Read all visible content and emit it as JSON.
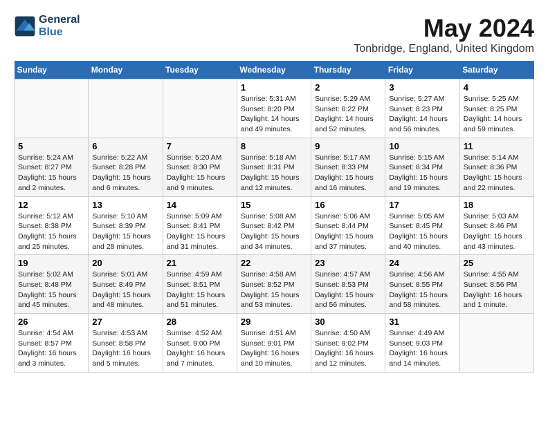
{
  "header": {
    "logo_line1": "General",
    "logo_line2": "Blue",
    "title": "May 2024",
    "subtitle": "Tonbridge, England, United Kingdom"
  },
  "calendar": {
    "days_of_week": [
      "Sunday",
      "Monday",
      "Tuesday",
      "Wednesday",
      "Thursday",
      "Friday",
      "Saturday"
    ],
    "weeks": [
      [
        {
          "num": "",
          "info": ""
        },
        {
          "num": "",
          "info": ""
        },
        {
          "num": "",
          "info": ""
        },
        {
          "num": "1",
          "info": "Sunrise: 5:31 AM\nSunset: 8:20 PM\nDaylight: 14 hours\nand 49 minutes."
        },
        {
          "num": "2",
          "info": "Sunrise: 5:29 AM\nSunset: 8:22 PM\nDaylight: 14 hours\nand 52 minutes."
        },
        {
          "num": "3",
          "info": "Sunrise: 5:27 AM\nSunset: 8:23 PM\nDaylight: 14 hours\nand 56 minutes."
        },
        {
          "num": "4",
          "info": "Sunrise: 5:25 AM\nSunset: 8:25 PM\nDaylight: 14 hours\nand 59 minutes."
        }
      ],
      [
        {
          "num": "5",
          "info": "Sunrise: 5:24 AM\nSunset: 8:27 PM\nDaylight: 15 hours\nand 2 minutes."
        },
        {
          "num": "6",
          "info": "Sunrise: 5:22 AM\nSunset: 8:28 PM\nDaylight: 15 hours\nand 6 minutes."
        },
        {
          "num": "7",
          "info": "Sunrise: 5:20 AM\nSunset: 8:30 PM\nDaylight: 15 hours\nand 9 minutes."
        },
        {
          "num": "8",
          "info": "Sunrise: 5:18 AM\nSunset: 8:31 PM\nDaylight: 15 hours\nand 12 minutes."
        },
        {
          "num": "9",
          "info": "Sunrise: 5:17 AM\nSunset: 8:33 PM\nDaylight: 15 hours\nand 16 minutes."
        },
        {
          "num": "10",
          "info": "Sunrise: 5:15 AM\nSunset: 8:34 PM\nDaylight: 15 hours\nand 19 minutes."
        },
        {
          "num": "11",
          "info": "Sunrise: 5:14 AM\nSunset: 8:36 PM\nDaylight: 15 hours\nand 22 minutes."
        }
      ],
      [
        {
          "num": "12",
          "info": "Sunrise: 5:12 AM\nSunset: 8:38 PM\nDaylight: 15 hours\nand 25 minutes."
        },
        {
          "num": "13",
          "info": "Sunrise: 5:10 AM\nSunset: 8:39 PM\nDaylight: 15 hours\nand 28 minutes."
        },
        {
          "num": "14",
          "info": "Sunrise: 5:09 AM\nSunset: 8:41 PM\nDaylight: 15 hours\nand 31 minutes."
        },
        {
          "num": "15",
          "info": "Sunrise: 5:08 AM\nSunset: 8:42 PM\nDaylight: 15 hours\nand 34 minutes."
        },
        {
          "num": "16",
          "info": "Sunrise: 5:06 AM\nSunset: 8:44 PM\nDaylight: 15 hours\nand 37 minutes."
        },
        {
          "num": "17",
          "info": "Sunrise: 5:05 AM\nSunset: 8:45 PM\nDaylight: 15 hours\nand 40 minutes."
        },
        {
          "num": "18",
          "info": "Sunrise: 5:03 AM\nSunset: 8:46 PM\nDaylight: 15 hours\nand 43 minutes."
        }
      ],
      [
        {
          "num": "19",
          "info": "Sunrise: 5:02 AM\nSunset: 8:48 PM\nDaylight: 15 hours\nand 45 minutes."
        },
        {
          "num": "20",
          "info": "Sunrise: 5:01 AM\nSunset: 8:49 PM\nDaylight: 15 hours\nand 48 minutes."
        },
        {
          "num": "21",
          "info": "Sunrise: 4:59 AM\nSunset: 8:51 PM\nDaylight: 15 hours\nand 51 minutes."
        },
        {
          "num": "22",
          "info": "Sunrise: 4:58 AM\nSunset: 8:52 PM\nDaylight: 15 hours\nand 53 minutes."
        },
        {
          "num": "23",
          "info": "Sunrise: 4:57 AM\nSunset: 8:53 PM\nDaylight: 15 hours\nand 56 minutes."
        },
        {
          "num": "24",
          "info": "Sunrise: 4:56 AM\nSunset: 8:55 PM\nDaylight: 15 hours\nand 58 minutes."
        },
        {
          "num": "25",
          "info": "Sunrise: 4:55 AM\nSunset: 8:56 PM\nDaylight: 16 hours\nand 1 minute."
        }
      ],
      [
        {
          "num": "26",
          "info": "Sunrise: 4:54 AM\nSunset: 8:57 PM\nDaylight: 16 hours\nand 3 minutes."
        },
        {
          "num": "27",
          "info": "Sunrise: 4:53 AM\nSunset: 8:58 PM\nDaylight: 16 hours\nand 5 minutes."
        },
        {
          "num": "28",
          "info": "Sunrise: 4:52 AM\nSunset: 9:00 PM\nDaylight: 16 hours\nand 7 minutes."
        },
        {
          "num": "29",
          "info": "Sunrise: 4:51 AM\nSunset: 9:01 PM\nDaylight: 16 hours\nand 10 minutes."
        },
        {
          "num": "30",
          "info": "Sunrise: 4:50 AM\nSunset: 9:02 PM\nDaylight: 16 hours\nand 12 minutes."
        },
        {
          "num": "31",
          "info": "Sunrise: 4:49 AM\nSunset: 9:03 PM\nDaylight: 16 hours\nand 14 minutes."
        },
        {
          "num": "",
          "info": ""
        }
      ]
    ]
  }
}
